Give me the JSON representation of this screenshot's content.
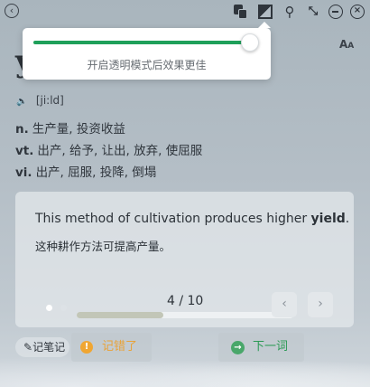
{
  "topbar": {
    "back_icon": "chevron-left-icon",
    "icons": [
      "copy-icon",
      "contrast-icon",
      "pin-icon",
      "shrink-icon",
      "minimize-icon",
      "close-icon"
    ]
  },
  "opacity_popup": {
    "hint": "开启透明模式后效果更佳",
    "slider_value": 1.0,
    "accent": "#1fa05a"
  },
  "word": {
    "headword_visible": "y",
    "phonetic": "[ji:ld]",
    "definitions": [
      {
        "pos": "n.",
        "meaning": "生产量, 投资收益"
      },
      {
        "pos": "vt.",
        "meaning": "出产, 给予, 让出, 放弃, 使屈服"
      },
      {
        "pos": "vi.",
        "meaning": "出产, 屈服, 投降, 倒塌"
      }
    ]
  },
  "font_size_label": "A",
  "example": {
    "sentence_before": "This method of cultivation produces higher ",
    "sentence_keyword": "yield",
    "sentence_after": ".",
    "translation": "这种耕作方法可提高产量。",
    "page_counter": "4 / 10",
    "progress": 0.4
  },
  "actions": {
    "note_label": "记笔记",
    "remember_label": "记错了",
    "next_label": "下一词",
    "remember_color": "#e8a33a",
    "next_color": "#2c9a55"
  }
}
